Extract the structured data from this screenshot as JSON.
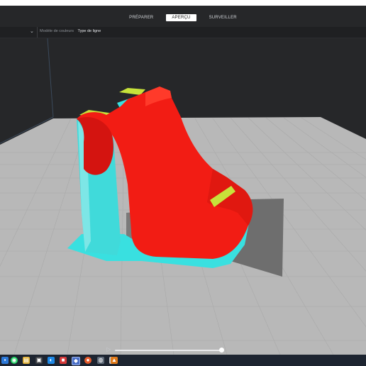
{
  "header": {
    "tabs": [
      {
        "label": "PRÉPARER",
        "active": false
      },
      {
        "label": "APERÇU",
        "active": true
      },
      {
        "label": "SURVEILLER",
        "active": false
      }
    ]
  },
  "toolbar": {
    "color_model_label": "Modèle de couleurs",
    "color_model_value": "Type de ligne"
  },
  "playback": {
    "progress": 1.0
  },
  "colors": {
    "model_red": "#f21c14",
    "support_cyan": "#39e0e0",
    "skin_yellow": "#c7e23a",
    "build_plate": "#b7b7b7",
    "background": "#262729"
  },
  "taskbar": {
    "icons": [
      "windows-icon",
      "whatsapp-icon",
      "file-explorer-icon",
      "store-icon",
      "edge-icon",
      "photos-icon",
      "cura-icon",
      "settings-icon",
      "chrome-icon",
      "folder-icon",
      "slicer-icon"
    ]
  }
}
